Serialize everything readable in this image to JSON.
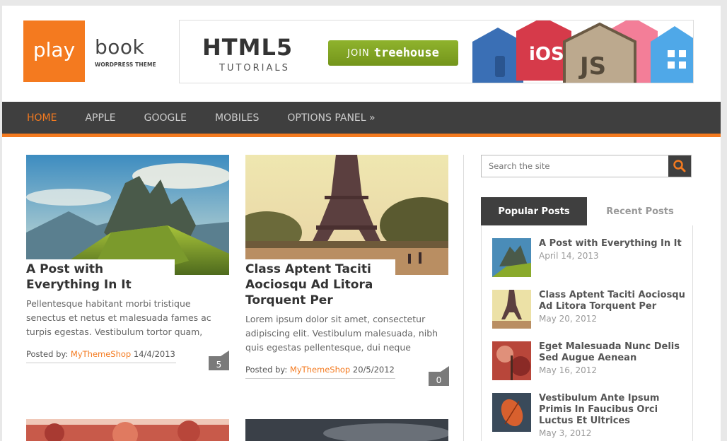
{
  "logo": {
    "box_text": "play",
    "word": "book",
    "sub": "WORDPRESS THEME"
  },
  "banner": {
    "headline": "HTML5",
    "subline": "TUTORIALS",
    "join_prefix": "JOIN",
    "join_brand": "treehouse",
    "badges": [
      "iOS",
      "JS"
    ]
  },
  "nav": {
    "items": [
      {
        "label": "HOME",
        "active": true
      },
      {
        "label": "APPLE"
      },
      {
        "label": "GOOGLE"
      },
      {
        "label": "MOBILES"
      },
      {
        "label": "OPTIONS PANEL »"
      }
    ]
  },
  "posts": [
    {
      "title": "A Post with Everything In It",
      "excerpt": "Pellentesque habitant morbi tristique senectus et netus et malesuada fames ac turpis egestas. Vestibulum tortor quam,",
      "posted_by": "Posted by:",
      "author": "MyThemeShop",
      "date": "14/4/2013",
      "comments": "5"
    },
    {
      "title": "Class Aptent Taciti Aociosqu Ad Litora Torquent Per",
      "excerpt": "Lorem ipsum dolor sit amet, consectetur adipiscing elit. Vestibulum malesuada, nibh quis egestas pellentesque, dui neque",
      "posted_by": "Posted by:",
      "author": "MyThemeShop",
      "date": "20/5/2012",
      "comments": "0"
    }
  ],
  "search": {
    "placeholder": "Search the site"
  },
  "tabs": {
    "popular": "Popular Posts",
    "recent": "Recent Posts"
  },
  "widget_posts": [
    {
      "title": "A Post with Everything In It",
      "date": "April 14, 2013"
    },
    {
      "title": "Class Aptent Taciti Aociosqu Ad Litora Torquent Per",
      "date": "May 20, 2012"
    },
    {
      "title": "Eget Malesuada Nunc Delis Sed Augue Aenean",
      "date": "May 16, 2012"
    },
    {
      "title": "Vestibulum Ante Ipsum Primis In Faucibus Orci Luctus Et Ultrices",
      "date": "May 3, 2012"
    }
  ],
  "colors": {
    "accent": "#f47a1f",
    "nav_bg": "#3f3f3f"
  }
}
